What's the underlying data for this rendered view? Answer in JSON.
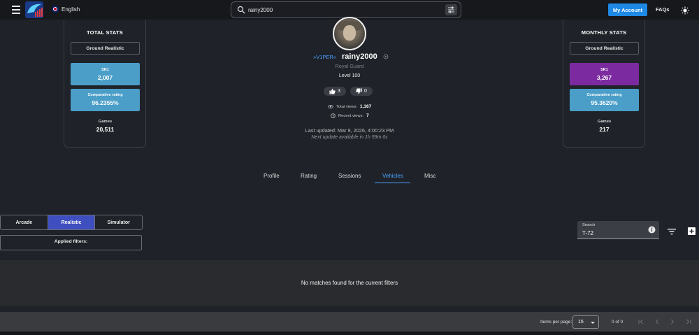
{
  "header": {
    "language": "English",
    "search_value": "rainy2000",
    "account_label": "My Account",
    "faqs_label": "FAQs",
    "icons": [
      "menu-icon",
      "logo-icon",
      "flag-icon",
      "search-icon",
      "tune-icon",
      "brightness-icon"
    ],
    "accent_color": "#1e88e5"
  },
  "total_stats": {
    "title": "TOTAL STATS",
    "mode": "Ground Realistic",
    "sr1_label": "SR1",
    "sr1_value": "2,007",
    "comp_label": "Comparative rating",
    "comp_value": "96.2355%",
    "games_label": "Games",
    "games_value": "20,511"
  },
  "monthly_stats": {
    "title": "MONTHLY STATS",
    "mode": "Ground Realistic",
    "sr1_label": "SR1",
    "sr1_value": "3,267",
    "comp_label": "Comparative rating",
    "comp_value": "95.3620%",
    "games_label": "Games",
    "games_value": "217",
    "sr1_color": "#7b2aa0"
  },
  "profile": {
    "clan": "»V1PER«",
    "username": "rainy2000",
    "title": "Royal Guard",
    "level": "Level 100",
    "likes": "3",
    "dislikes": "0",
    "total_views_label": "Total views:",
    "total_views": "1,167",
    "recent_views_label": "Recent views:",
    "recent_views": "7",
    "last_updated": "Last updated: Mar 9, 2026, 4:00:23 PM",
    "next_update": "Next update available in 1h 59m 6s"
  },
  "tabs": [
    {
      "label": "Profile"
    },
    {
      "label": "Rating"
    },
    {
      "label": "Sessions"
    },
    {
      "label": "Vehicles",
      "active": true
    },
    {
      "label": "Misc"
    }
  ],
  "modes": [
    {
      "label": "Arcade"
    },
    {
      "label": "Realistic",
      "active": true
    },
    {
      "label": "Simulator"
    }
  ],
  "applied_filters_label": "Applied filters:",
  "vehicle_search": {
    "label": "Search",
    "value": "T-72"
  },
  "results": {
    "empty_message": "No matches found for the current filters"
  },
  "paginator": {
    "items_per_page_label": "Items per page:",
    "items_per_page": "15",
    "range": "0 of 0"
  }
}
